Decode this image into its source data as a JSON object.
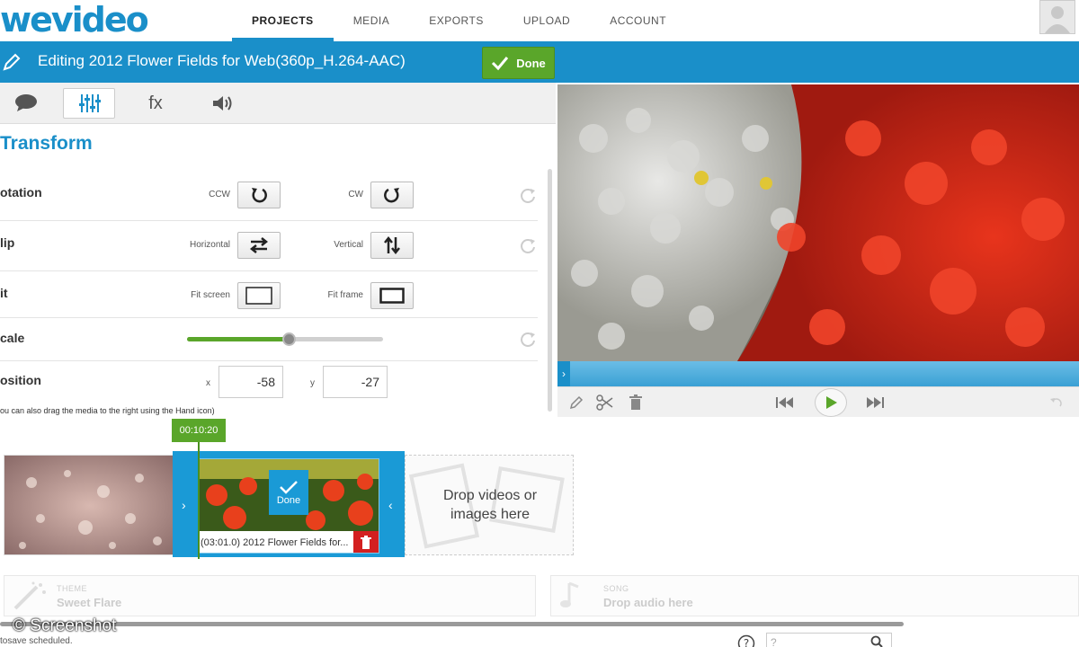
{
  "brand": {
    "logo": "wevideo",
    "accent": "#1a8fc9",
    "green": "#5aa62a"
  },
  "nav": {
    "items": [
      "PROJECTS",
      "MEDIA",
      "EXPORTS",
      "UPLOAD",
      "ACCOUNT"
    ],
    "active": "PROJECTS"
  },
  "titlebar": {
    "title": "Editing 2012 Flower Fields for Web(360p_H.264-AAC)",
    "done_label": "Done"
  },
  "tabs": [
    {
      "name": "comment-icon"
    },
    {
      "name": "sliders-icon",
      "active": true
    },
    {
      "name": "fx",
      "label": "fx"
    },
    {
      "name": "volume-icon"
    }
  ],
  "transform": {
    "title": "Transform",
    "rotation": {
      "label": "otation",
      "ccw": "CCW",
      "cw": "CW"
    },
    "flip": {
      "label": "lip",
      "horizontal": "Horizontal",
      "vertical": "Vertical"
    },
    "fit": {
      "label": "it",
      "fit_screen": "Fit screen",
      "fit_frame": "Fit frame"
    },
    "scale": {
      "label": "cale",
      "value_fraction": 0.52
    },
    "position": {
      "label": "osition",
      "x_label": "x",
      "x_value": "-58",
      "y_label": "y",
      "y_value": "-27"
    },
    "hint": "ou can also drag the media to the right using the Hand icon)"
  },
  "timeline": {
    "marker_time": "00:10:20",
    "clip_caption": "(03:01.0) 2012 Flower Fields for...",
    "clip_done": "Done",
    "drop_text_1": "Drop videos or",
    "drop_text_2": "images here"
  },
  "theme": {
    "caption": "THEME",
    "value": "Sweet Flare"
  },
  "song": {
    "caption": "SONG",
    "value": "Drop audio here"
  },
  "status": {
    "text": "tosave scheduled."
  },
  "watermark": "© Screenshot",
  "search": {
    "placeholder": "?"
  }
}
